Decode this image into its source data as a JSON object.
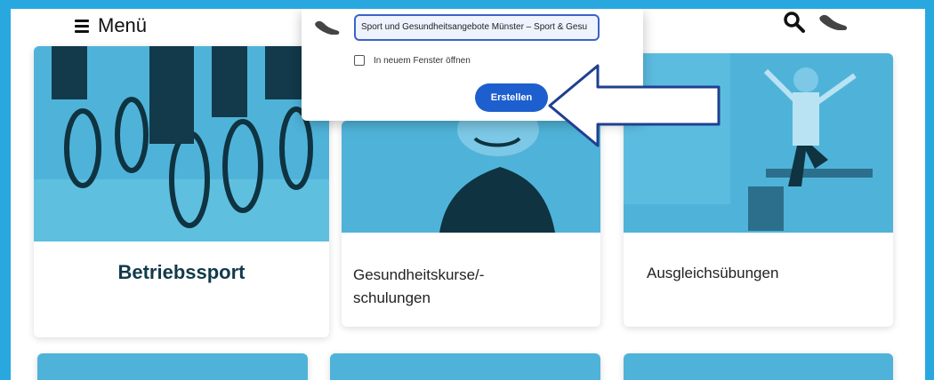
{
  "header": {
    "menu_label": "Menü",
    "icons": [
      "hamburger-icon",
      "search-icon",
      "shoe-icon"
    ]
  },
  "dialog": {
    "icon": "shoe-icon",
    "url_value": "Sport und Gesundheitsangebote Münster – Sport & Gesu",
    "new_window_label": "In neuem Fenster öffnen",
    "new_window_checked": false,
    "create_label": "Erstellen"
  },
  "cards": [
    {
      "title": "Betriebssport"
    },
    {
      "title_line1": "Gesundheitskurse/-",
      "title_line2": "schulungen"
    },
    {
      "title": "Ausgleichsübungen"
    }
  ],
  "colors": {
    "frame": "#29a8df",
    "image_tint": "#4fb3d9",
    "dialog_accent": "#1d5fce",
    "card_title_dark": "#123a4a"
  }
}
